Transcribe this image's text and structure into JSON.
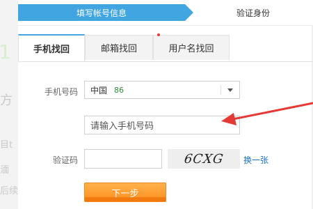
{
  "steps": {
    "step1": "填写帐号信息",
    "step2": "验证身份"
  },
  "tabs": [
    {
      "label": "手机找回",
      "active": true
    },
    {
      "label": "邮箱找回",
      "active": false
    },
    {
      "label": "用户名找回",
      "active": false
    }
  ],
  "form": {
    "phone_label": "手机号码",
    "country": "中国",
    "country_code": "86",
    "phone_placeholder": "请输入手机号码",
    "code_label": "验证码",
    "code_value": "",
    "captcha_text": "6CXG",
    "refresh_link": "换一张",
    "next_button": "下一步"
  },
  "background": {
    "frag1": "1",
    "frag2": "方",
    "frag3": "目t",
    "frag4": "湎",
    "frag5": "后续"
  },
  "colors": {
    "accent": "#41a5e1",
    "button": "#ff8e1f",
    "arrow": "#e53935",
    "link": "#1a73c9"
  }
}
